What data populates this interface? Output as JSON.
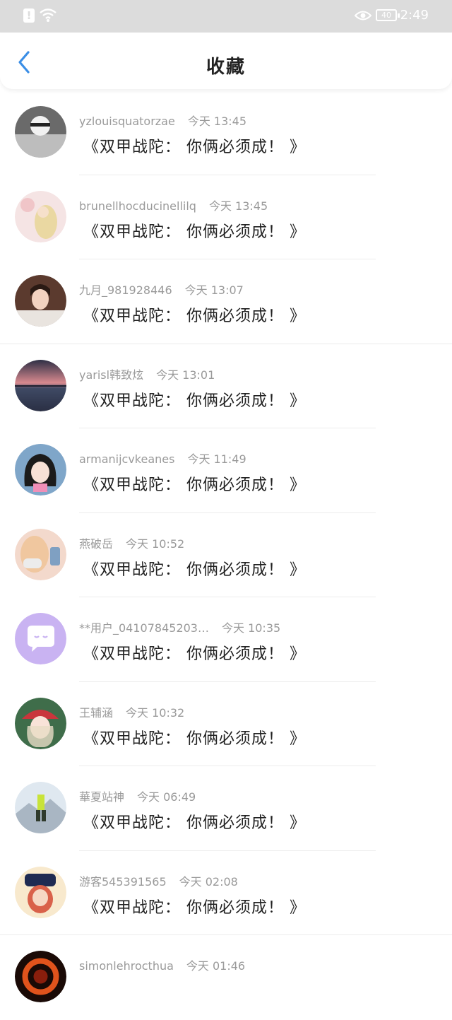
{
  "status_bar": {
    "time": "2:49",
    "battery": "40",
    "icons": [
      "alert-icon",
      "wifi-icon",
      "eye-icon",
      "battery-icon"
    ]
  },
  "nav": {
    "title": "收藏",
    "back_icon": "chevron-left-icon"
  },
  "colors": {
    "accent": "#3a8ee6",
    "status_bar": "#dcdcdc",
    "meta_text": "#9a9a9a",
    "message_text": "#222222"
  },
  "items": [
    {
      "user": "yzlouisquatorzae",
      "time": "今天 13:45",
      "message": "《双甲战陀： 你俩必须成！ 》"
    },
    {
      "user": "brunellhocducinellilq",
      "time": "今天 13:45",
      "message": "《双甲战陀： 你俩必须成！ 》"
    },
    {
      "user": "九月_981928446",
      "time": "今天 13:07",
      "message": "《双甲战陀： 你俩必须成！ 》"
    },
    {
      "user": "yarisl韩致炫",
      "time": "今天 13:01",
      "message": "《双甲战陀： 你俩必须成！ 》"
    },
    {
      "user": "armanijcvkeanes",
      "time": "今天 11:49",
      "message": "《双甲战陀： 你俩必须成！ 》"
    },
    {
      "user": "燕破岳",
      "time": "今天 10:52",
      "message": "《双甲战陀： 你俩必须成！ 》"
    },
    {
      "user": "**用户_04107845203…",
      "time": "今天 10:35",
      "message": "《双甲战陀： 你俩必须成！ 》"
    },
    {
      "user": "王辅涵",
      "time": "今天 10:32",
      "message": "《双甲战陀： 你俩必须成！ 》"
    },
    {
      "user": "華夏站神",
      "time": "今天 06:49",
      "message": "《双甲战陀： 你俩必须成！ 》"
    },
    {
      "user": "游客545391565",
      "time": "今天 02:08",
      "message": "《双甲战陀： 你俩必须成！ 》"
    },
    {
      "user": "simonlehrocthua",
      "time": "今天 01:46",
      "message": ""
    }
  ]
}
